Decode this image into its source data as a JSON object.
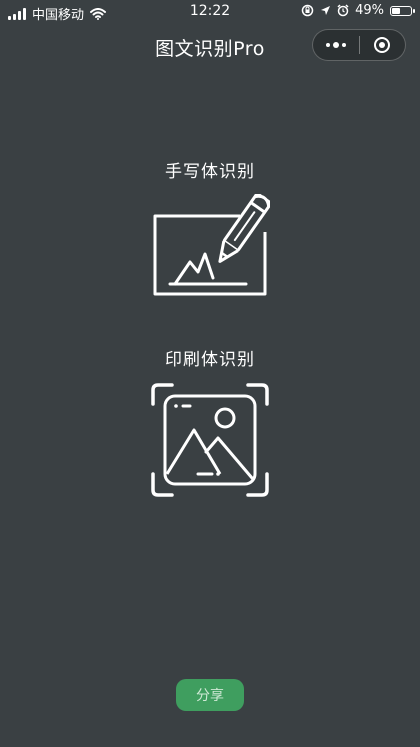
{
  "status_bar": {
    "carrier": "中国移动",
    "time": "12:22",
    "battery_text": "49%",
    "battery_level": 0.49,
    "icons": [
      "signal-icon",
      "wifi-icon",
      "orientation-lock-icon",
      "location-icon",
      "alarm-icon",
      "battery-icon"
    ]
  },
  "nav": {
    "title": "图文识别Pro",
    "capsule_icons": [
      "more-dots-icon",
      "close-target-icon"
    ]
  },
  "options": [
    {
      "label": "手写体识别",
      "icon": "handwriting-pencil-icon"
    },
    {
      "label": "印刷体识别",
      "icon": "image-scan-icon"
    }
  ],
  "share": {
    "label": "分享",
    "color": "#3f9e5f"
  },
  "colors": {
    "background": "#3a4043",
    "foreground": "#ffffff",
    "accent": "#3f9e5f"
  }
}
